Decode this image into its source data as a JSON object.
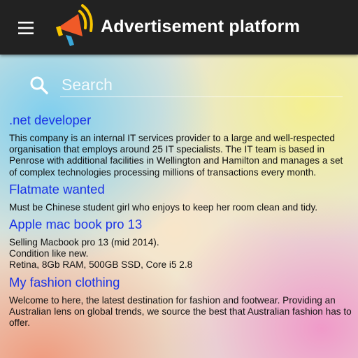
{
  "app_bar": {
    "title": "Advertisement platform",
    "background": "#222222",
    "menu_icon": "hamburger-menu-icon",
    "logo_icon": "megaphone-icon"
  },
  "search": {
    "placeholder": "Search",
    "value": "",
    "icon": "search-icon"
  },
  "listings": [
    {
      "title": ".net developer",
      "description": "This company is an internal IT services provider to a large and well-respected organisation that employs around 25 IT specialists. The IT team is based in Penrose with additional facilities in Wellington and Hamilton and manages a set of complex technologies processing millions of transactions every month."
    },
    {
      "title": "Flatmate wanted",
      "description": "Must be Chinese student girl who enjoys to keep her room clean and tidy."
    },
    {
      "title": "Apple mac book pro 13",
      "description": "Selling Macbook pro 13 (mid 2014).\nCondition like new.\nRetina, 8Gb RAM, 500GB SSD, Core i5 2.8"
    },
    {
      "title": "My fashion clothing",
      "description": "Welcome to here, the latest destination for fashion and footwear. Providing an Australian lens on global trends, we source the best that Australian fashion has to offer."
    }
  ],
  "colors": {
    "link_blue": "#1a33e6",
    "logo_orange": "#f05a28",
    "logo_yellow": "#f7c400",
    "logo_blue": "#3aa7d8"
  }
}
